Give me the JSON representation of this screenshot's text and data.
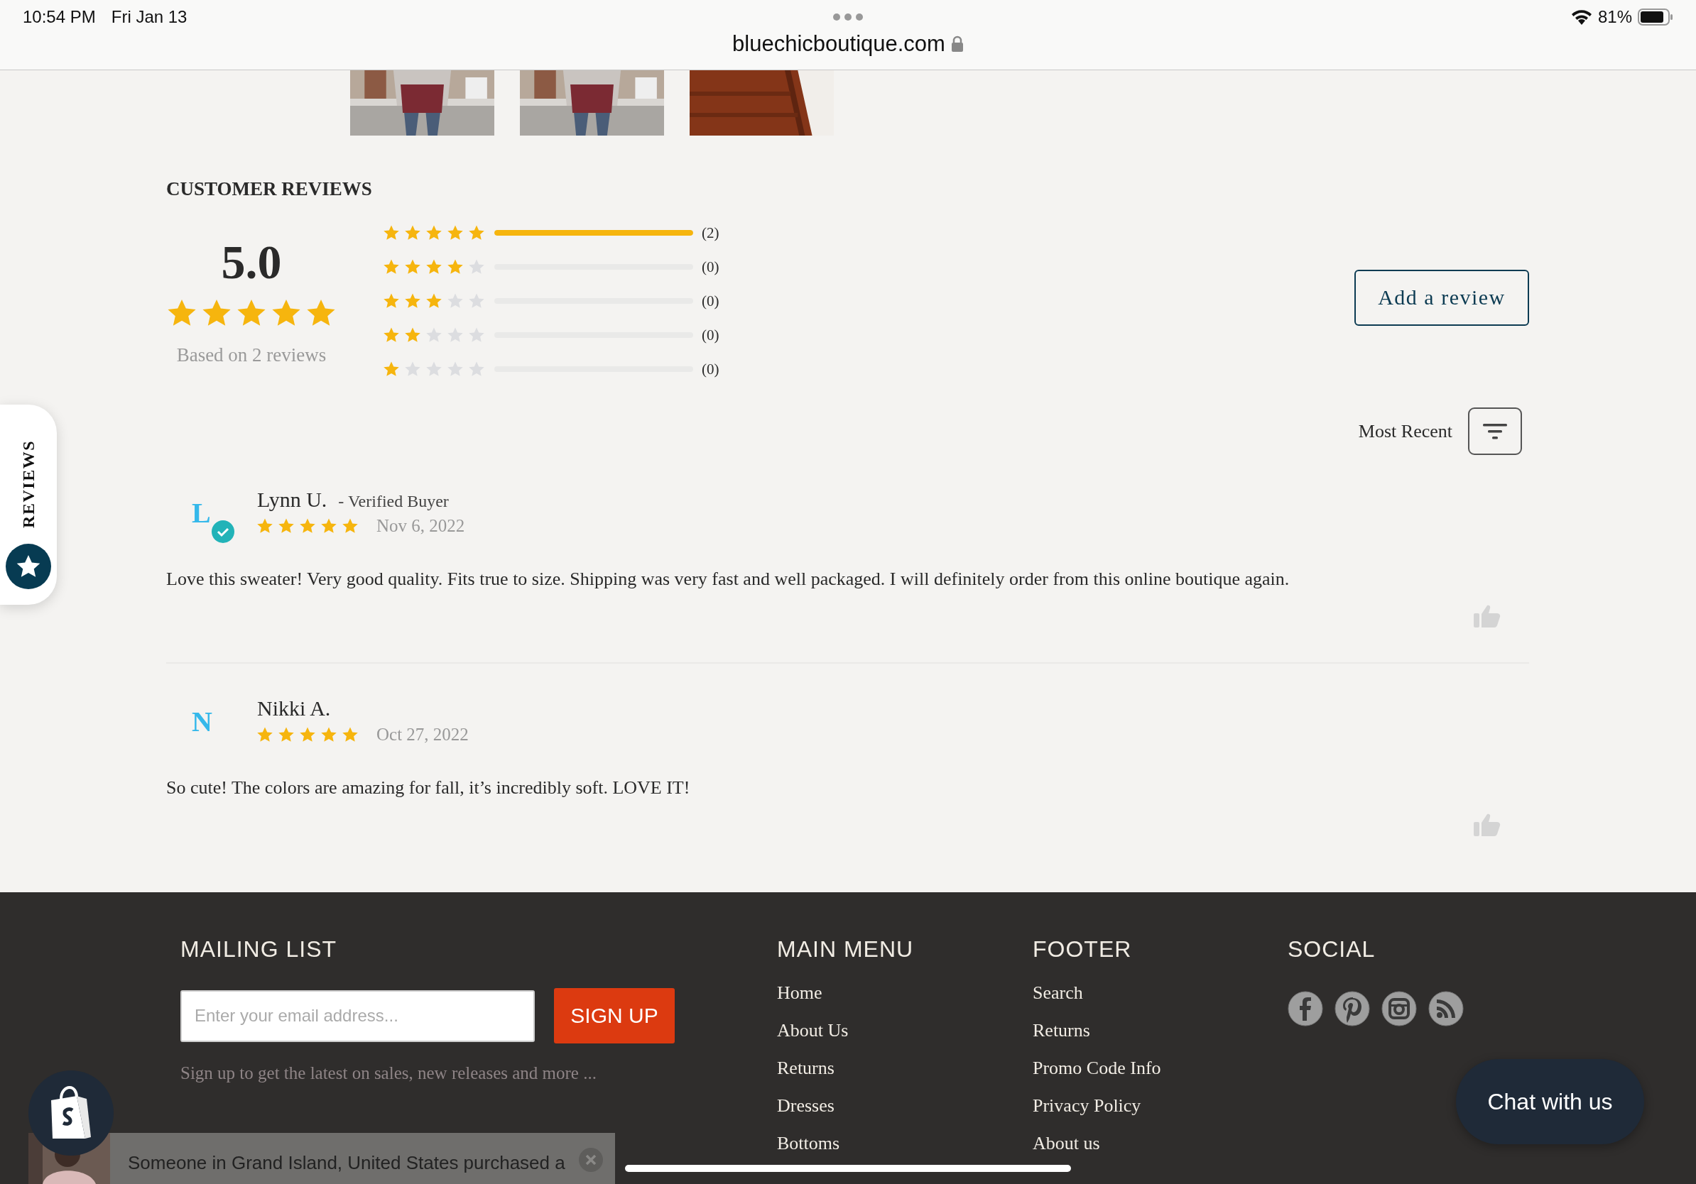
{
  "status_bar": {
    "time": "10:54 PM",
    "date": "Fri Jan 13",
    "battery": "81%"
  },
  "browser": {
    "url": "bluechicboutique.com"
  },
  "reviews_tab": {
    "label": "REVIEWS"
  },
  "summary": {
    "title": "CUSTOMER REVIEWS",
    "average": "5.0",
    "stars": 5,
    "based_on": "Based on 2 reviews",
    "add_button": "Add a review",
    "sort": "Most Recent",
    "histogram": [
      {
        "stars": 5,
        "level": 1,
        "count": "(2)"
      },
      {
        "stars": 4,
        "level": 0,
        "count": "(0)"
      },
      {
        "stars": 3,
        "level": 0,
        "count": "(0)"
      },
      {
        "stars": 2,
        "level": 0,
        "count": "(0)"
      },
      {
        "stars": 1,
        "level": 0,
        "count": "(0)"
      }
    ]
  },
  "reviews": [
    {
      "initial": "L",
      "verified": true,
      "name": "Lynn U.",
      "badge": "- Verified Buyer",
      "stars": 5,
      "date": "Nov 6, 2022",
      "body": "Love this sweater! Very good quality. Fits true to size. Shipping was very fast and well packaged. I will definitely order from this online boutique again."
    },
    {
      "initial": "N",
      "verified": false,
      "name": "Nikki A.",
      "stars": 5,
      "date": "Oct 27, 2022",
      "body": "So cute! The colors are amazing for fall, it’s incredibly soft. LOVE IT!"
    }
  ],
  "footer": {
    "mailing": {
      "title": "MAILING LIST",
      "placeholder": "Enter your email address...",
      "button": "SIGN UP",
      "note": "Sign up to get the latest on sales, new releases and more ..."
    },
    "menus": [
      {
        "title": "MAIN MENU",
        "items": [
          "Home",
          "About Us",
          "Returns",
          "Dresses",
          "Bottoms"
        ]
      },
      {
        "title": "FOOTER",
        "items": [
          "Search",
          "Returns",
          "Promo Code Info",
          "Privacy Policy",
          "About us"
        ]
      }
    ],
    "social": {
      "title": "SOCIAL",
      "icons": [
        {
          "kind": "facebook"
        },
        {
          "kind": "pinterest"
        },
        {
          "kind": "instagram"
        },
        {
          "kind": "rss"
        }
      ]
    }
  },
  "chat_button": "Chat with us",
  "notification": {
    "text": "Someone in Grand Island, United States purchased a"
  }
}
